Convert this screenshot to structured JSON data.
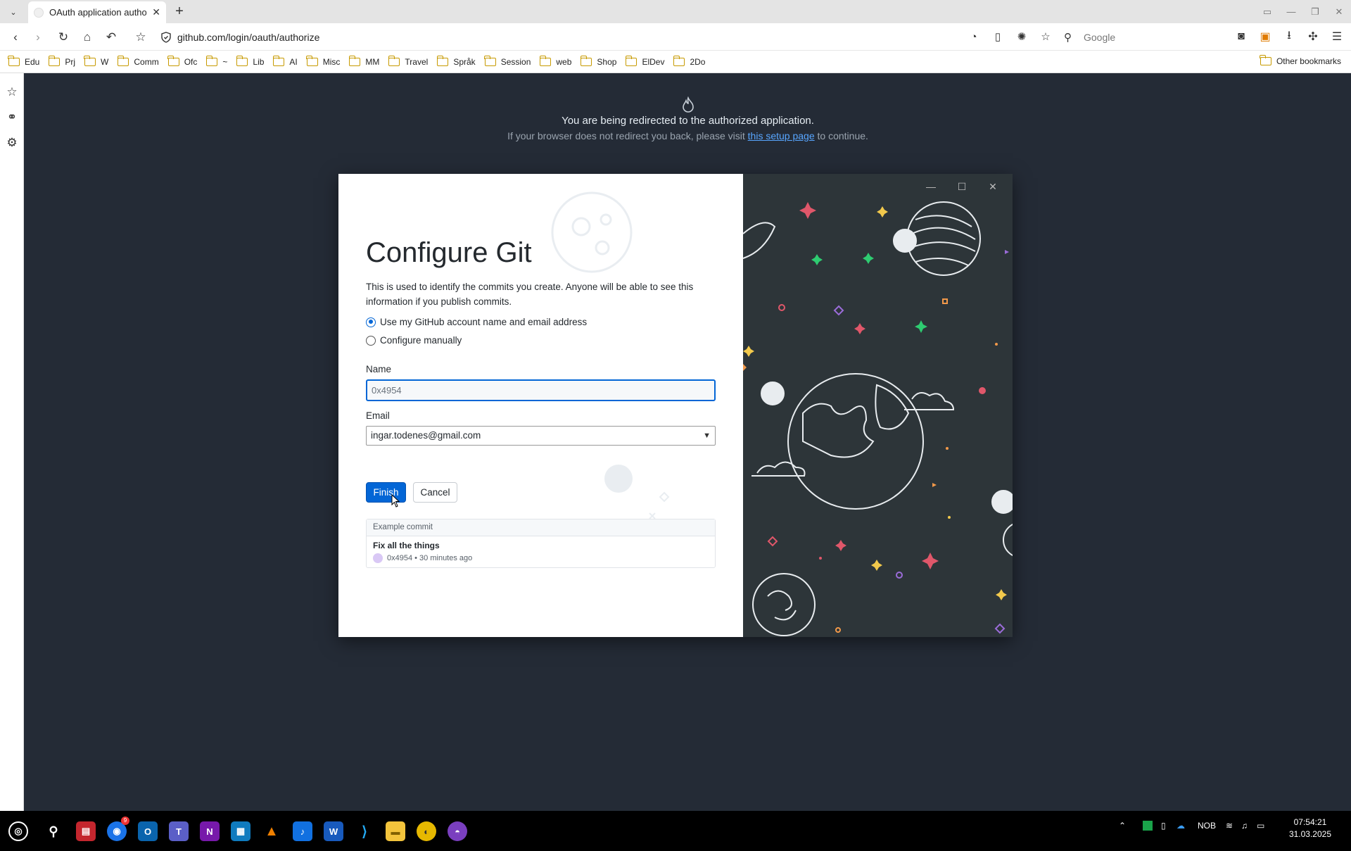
{
  "browser": {
    "tab_title": "OAuth application autho",
    "url": "github.com/login/oauth/authorize",
    "search_placeholder": "Google",
    "bookmarks": [
      "Edu",
      "Prj",
      "W",
      "Comm",
      "Ofc",
      "~",
      "Lib",
      "AI",
      "Misc",
      "MM",
      "Travel",
      "Språk",
      "Session",
      "web",
      "Shop",
      "ElDev",
      "2Do"
    ],
    "other_bookmarks": "Other bookmarks"
  },
  "page": {
    "redirect_message": "You are being redirected to the authorized application.",
    "redirect_sub_before": "If your browser does not redirect you back, please visit",
    "redirect_link": "this setup page",
    "redirect_sub_after": "to continue."
  },
  "dialog": {
    "title": "Configure Git",
    "description": "This is used to identify the commits you create. Anyone will be able to see this information if you publish commits.",
    "option_account": "Use my GitHub account name and email address",
    "option_manual": "Configure manually",
    "selected_option": "account",
    "name_label": "Name",
    "name_value": "0x4954",
    "email_label": "Email",
    "email_value": "ingar.todenes@gmail.com",
    "finish_label": "Finish",
    "cancel_label": "Cancel",
    "example_heading": "Example commit",
    "example_message": "Fix all the things",
    "example_meta": "0x4954 • 30 minutes ago"
  },
  "taskbar": {
    "language": "NOB",
    "time": "07:54:21",
    "date": "31.03.2025",
    "badge_count": "9"
  },
  "colors": {
    "accent": "#0366d6",
    "page_bg": "#242b36",
    "illustration_bg": "#2d3539"
  }
}
